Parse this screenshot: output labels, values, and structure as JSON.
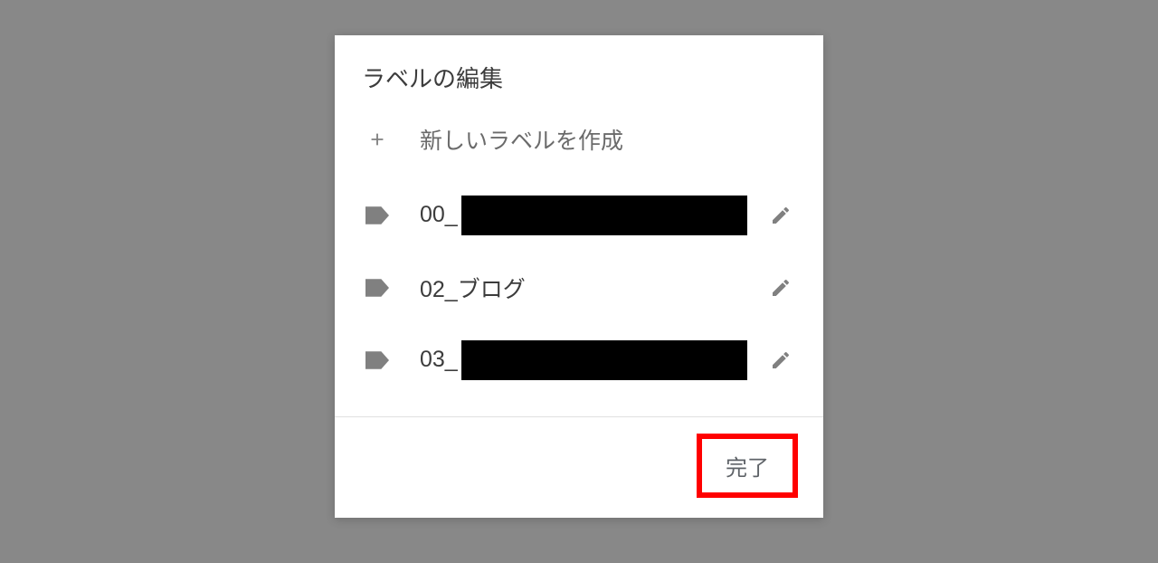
{
  "dialog": {
    "title": "ラベルの編集",
    "create_label": "新しいラベルを作成",
    "labels": [
      {
        "prefix": "00_",
        "redacted": true
      },
      {
        "prefix": "02_ブログ",
        "redacted": false
      },
      {
        "prefix": "03_",
        "redacted": true
      }
    ],
    "done_button": "完了"
  }
}
